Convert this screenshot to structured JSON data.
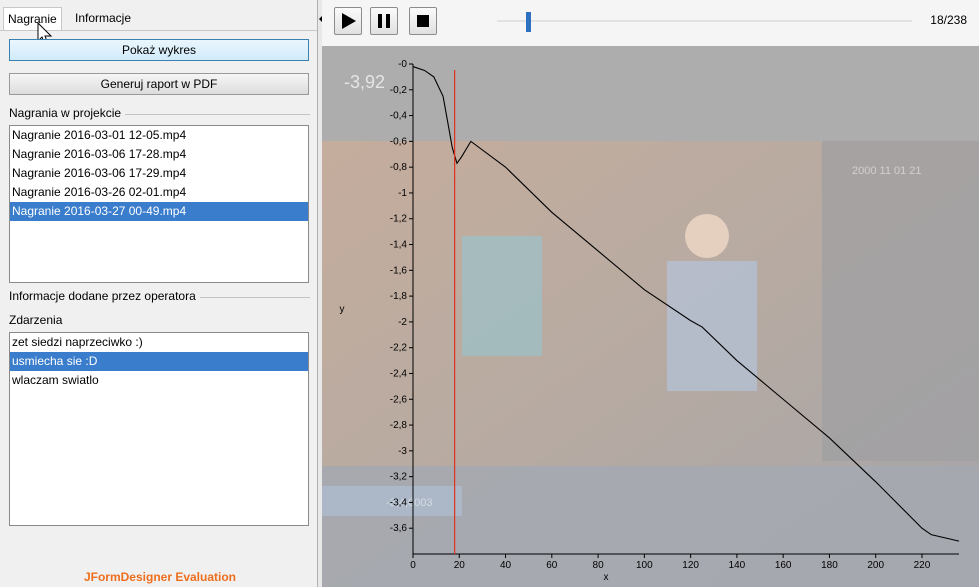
{
  "tabs": {
    "recording": "Nagranie",
    "info": "Informacje"
  },
  "buttons": {
    "show_chart": "Pokaż wykres",
    "pdf_report": "Generuj raport w PDF"
  },
  "sections": {
    "recordings": "Nagrania w projekcie",
    "operator_info": "Informacje dodane przez operatora",
    "events": "Zdarzenia"
  },
  "recordings": [
    "Nagranie 2016-03-01 12-05.mp4",
    "Nagranie 2016-03-06 17-28.mp4",
    "Nagranie 2016-03-06 17-29.mp4",
    "Nagranie 2016-03-26 02-01.mp4",
    "Nagranie 2016-03-27 00-49.mp4"
  ],
  "recordings_selected": 4,
  "events": [
    "zet siedzi naprzeciwko :)",
    "usmiecha sie :D",
    "wlaczam swiatlo"
  ],
  "events_selected": 1,
  "evaluation": "JFormDesigner Evaluation",
  "player": {
    "frame_counter": "18/238",
    "position_fraction": 0.0756
  },
  "video_overlay": {
    "value_top": "-3,92",
    "value_bottom": "-3,4,0003",
    "timestamp": "2000 11 01 21"
  },
  "colors": {
    "selection": "#3a7dcc",
    "evaluation": "#ee6e1e",
    "marker": "#e03020",
    "slider": "#2f6fbf"
  },
  "icons": {
    "play": "play-icon",
    "pause": "pause-icon",
    "stop": "stop-icon",
    "cursor": "mouse-cursor-icon"
  },
  "chart_data": {
    "type": "line",
    "xlabel": "x",
    "ylabel": "y",
    "xlim": [
      0,
      236
    ],
    "ylim": [
      -3.8,
      0
    ],
    "x_ticks": [
      "0",
      "20",
      "40",
      "60",
      "80",
      "100",
      "120",
      "140",
      "160",
      "180",
      "200",
      "220"
    ],
    "y_ticks": [
      "-0",
      "-0,2",
      "-0,4",
      "-0,6",
      "-0,8",
      "-1",
      "-1,2",
      "-1,4",
      "-1,6",
      "-1,8",
      "-2",
      "-2,2",
      "-2,4",
      "-2,6",
      "-2,8",
      "-3",
      "-3,2",
      "-3,4",
      "-3,6"
    ],
    "marker_x": 18,
    "series": [
      {
        "x": [
          0,
          5,
          9,
          13,
          15,
          17,
          19,
          21,
          25,
          40,
          60,
          80,
          100,
          120,
          125,
          140,
          160,
          180,
          200,
          220,
          224,
          236
        ],
        "y": [
          -0.02,
          -0.05,
          -0.1,
          -0.25,
          -0.45,
          -0.65,
          -0.77,
          -0.72,
          -0.6,
          -0.8,
          -1.15,
          -1.45,
          -1.75,
          -1.99,
          -2.04,
          -2.3,
          -2.6,
          -2.9,
          -3.24,
          -3.6,
          -3.65,
          -3.7
        ]
      }
    ]
  }
}
